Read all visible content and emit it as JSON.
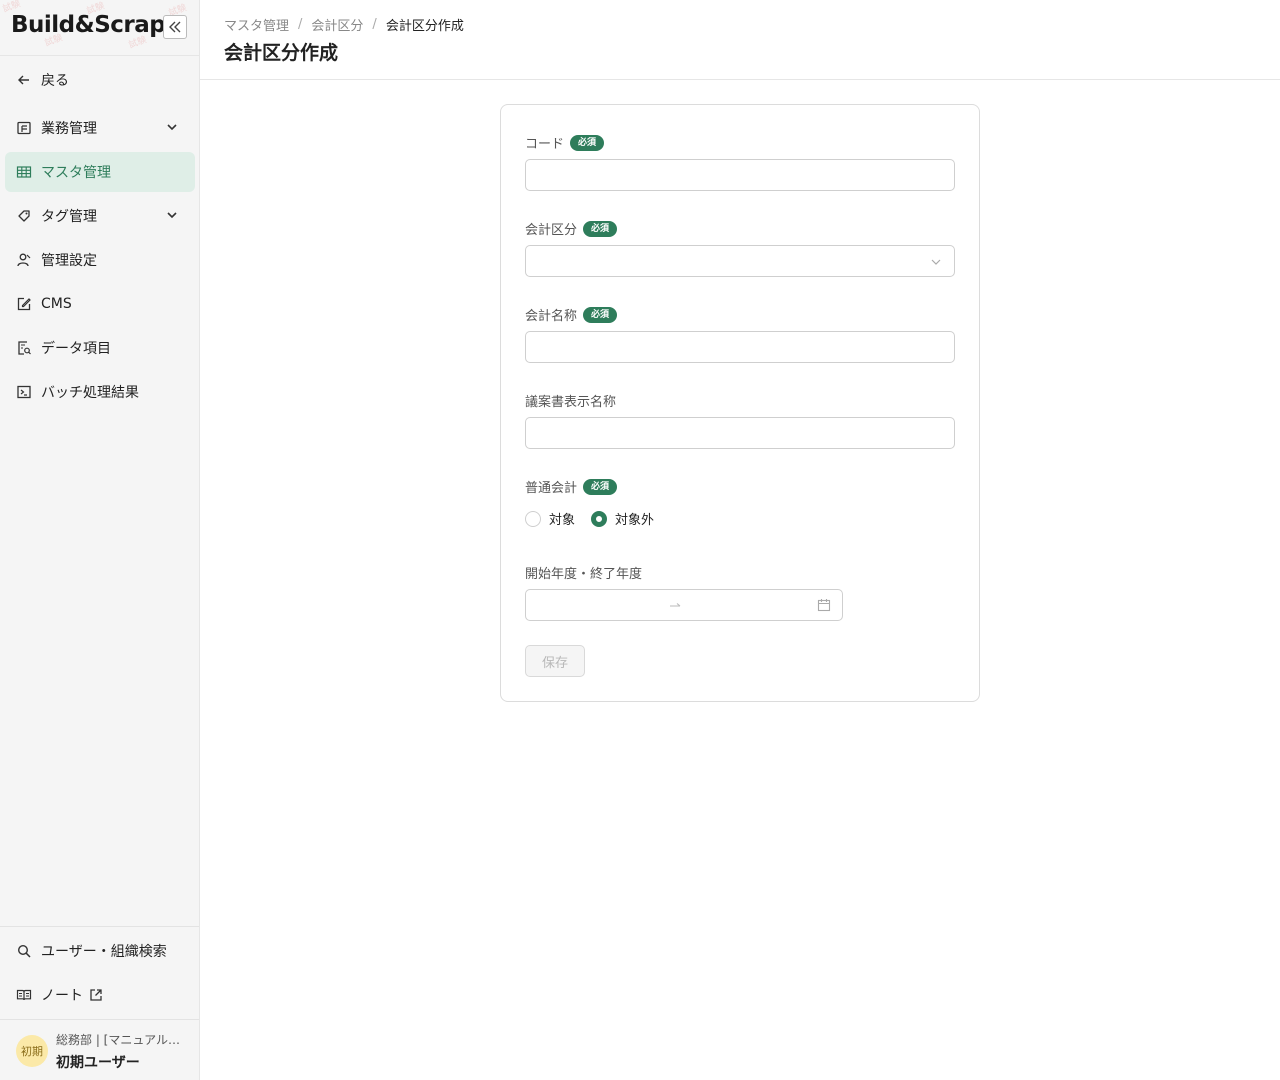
{
  "app": {
    "logo_text": "Build&Scrap"
  },
  "sidebar": {
    "back_label": "戻る",
    "items": [
      {
        "label": "業務管理",
        "icon": "task-board-icon",
        "expandable": true,
        "active": false
      },
      {
        "label": "マスタ管理",
        "icon": "table-grid-icon",
        "expandable": false,
        "active": true
      },
      {
        "label": "タグ管理",
        "icon": "tag-icon",
        "expandable": true,
        "active": false
      },
      {
        "label": "管理設定",
        "icon": "users-icon",
        "expandable": false,
        "active": false
      },
      {
        "label": "CMS",
        "icon": "edit-icon",
        "expandable": false,
        "active": false
      },
      {
        "label": "データ項目",
        "icon": "document-search-icon",
        "expandable": false,
        "active": false
      },
      {
        "label": "バッチ処理結果",
        "icon": "terminal-icon",
        "expandable": false,
        "active": false
      }
    ],
    "bottom_items": [
      {
        "label": "ユーザー・組織検索",
        "icon": "search-icon"
      },
      {
        "label": "ノート",
        "icon": "book-icon",
        "external": true
      }
    ],
    "user": {
      "avatar_text": "初期",
      "org": "総務部 | [マニュアル…",
      "name": "初期ユーザー"
    }
  },
  "header": {
    "breadcrumb": [
      "マスタ管理",
      "会計区分",
      "会計区分作成"
    ],
    "title": "会計区分作成"
  },
  "form": {
    "required_badge": "必須",
    "fields": {
      "code": {
        "label": "コード",
        "required": true,
        "value": ""
      },
      "category": {
        "label": "会計区分",
        "required": true,
        "selected": ""
      },
      "name": {
        "label": "会計名称",
        "required": true,
        "value": ""
      },
      "display_name": {
        "label": "議案書表示名称",
        "required": false,
        "value": ""
      },
      "general_account": {
        "label": "普通会計",
        "required": true,
        "options": [
          "対象",
          "対象外"
        ],
        "selected": "対象外"
      },
      "period": {
        "label": "開始年度・終了年度",
        "required": false,
        "start": "",
        "end": ""
      }
    },
    "save_label": "保存"
  },
  "colors": {
    "accent": "#2e7d5b",
    "active_bg": "#dfeee7",
    "avatar_bg": "#fbe9a8"
  }
}
